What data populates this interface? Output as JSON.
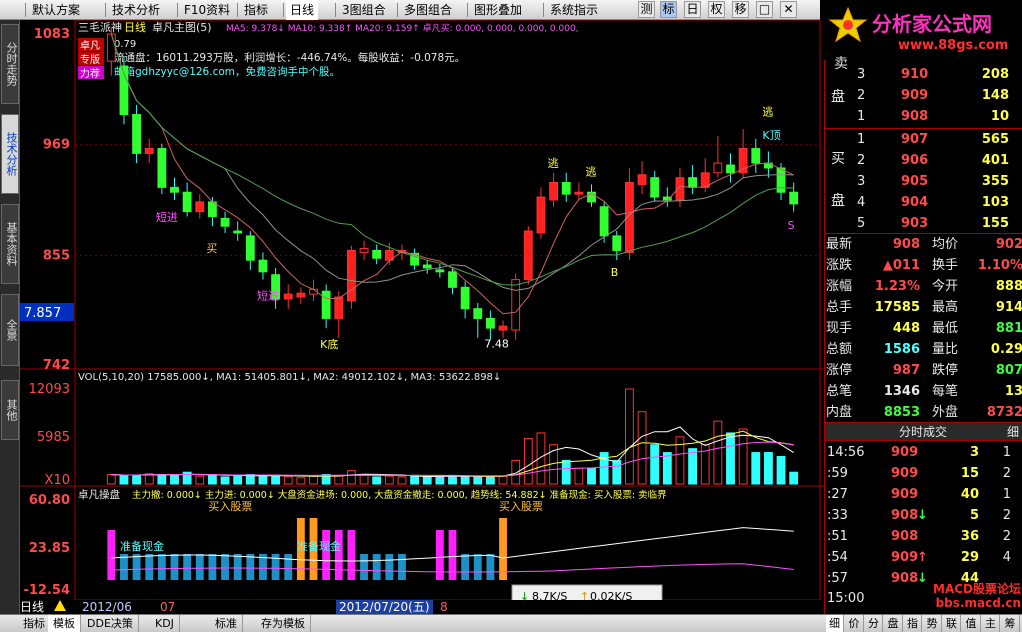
{
  "menu": {
    "items": [
      "默认方案",
      "技术分析",
      "F10资料",
      "指标",
      "日线",
      "3图组合",
      "多图组合",
      "图形叠加",
      "系统指示"
    ],
    "toolbar": [
      "测",
      "标",
      "日",
      "权",
      "移",
      "□",
      "✕"
    ]
  },
  "brand": {
    "name": "分析家公式网",
    "url": "www.88gs.com"
  },
  "left_tabs": [
    "分时走势",
    "技术分析",
    "基本资料",
    "全景",
    "其他"
  ],
  "main": {
    "title": "三毛派神",
    "period": "日线",
    "indicator_title": "卓凡主图(5)",
    "ma_line": "MA5: 9.378↓  MA10: 9.338↑  MA20: 9.159↑  卓凡买: 0.000, 0.000, 0.000, 0.000,",
    "info_line1": "流通盘：16011.293万股，利润增长：-446.74%。每股收益：-0.078元。",
    "info_line2": "邮箱gdhzyyc@126.com，免费咨询手中个股。",
    "price_first": "0.79",
    "side_badges": [
      "卓凡",
      "专版",
      "力荐"
    ],
    "current_price_label": "7.857",
    "y_labels": [
      "1083",
      "969",
      "855",
      "742"
    ],
    "candle_labels": {
      "short_in": "短进",
      "buy": "买",
      "buy_in": "短进",
      "escape": "逃",
      "escape2": "逃",
      "kpeak": "K顶",
      "kbottom": "K底",
      "low_price": "7.48",
      "b": "B",
      "s": "S"
    },
    "vol_title": "VOL(5,10,20)  17585.000↓, MA1: 51405.801↓, MA2: 49012.102↓, MA3: 53622.898↓",
    "vol_labels": [
      "12093",
      "5985",
      "X10"
    ],
    "ind_title": "卓凡操盘",
    "ind_line": "主力撤: 0.000↓  主力进: 0.000↓  大盘资金进场: 0.000, 大盘资金撤走: 0.000, 趋势线: 54.882↓  准备现金: 买入股票: 卖临界",
    "ind_labels": [
      "60.80",
      "23.85",
      "-12.54"
    ],
    "ind_marks": [
      "准备现金",
      "准备现金",
      "买入股票",
      "买入股票"
    ],
    "date_labels": [
      "日线",
      "2012/06",
      "07",
      "2012/07/20(五)",
      "8"
    ],
    "status_speed": [
      "8.7K/S",
      "0.02K/S"
    ]
  },
  "orderbook": {
    "sell_label": "卖盘",
    "buy_label": "买盘",
    "sell": [
      {
        "lvl": "3",
        "price": "910",
        "vol": "208"
      },
      {
        "lvl": "2",
        "price": "909",
        "vol": "148"
      },
      {
        "lvl": "1",
        "price": "908",
        "vol": "10"
      }
    ],
    "buy": [
      {
        "lvl": "1",
        "price": "907",
        "vol": "565"
      },
      {
        "lvl": "2",
        "price": "906",
        "vol": "401"
      },
      {
        "lvl": "3",
        "price": "905",
        "vol": "355"
      },
      {
        "lvl": "4",
        "price": "904",
        "vol": "103"
      },
      {
        "lvl": "5",
        "price": "903",
        "vol": "155"
      }
    ]
  },
  "quote": [
    {
      "k1": "最新",
      "v1": "908",
      "k2": "均价",
      "v2": "902"
    },
    {
      "k1": "涨跌",
      "v1": "▲011",
      "k2": "换手",
      "v2": "1.10%"
    },
    {
      "k1": "涨幅",
      "v1": "1.23%",
      "k2": "今开",
      "v2": "888"
    },
    {
      "k1": "总手",
      "v1": "17585",
      "k2": "最高",
      "v2": "914"
    },
    {
      "k1": "现手",
      "v1": "448",
      "k2": "最低",
      "v2": "881"
    },
    {
      "k1": "总额",
      "v1": "1586",
      "k2": "量比",
      "v2": "0.29"
    },
    {
      "k1": "涨停",
      "v1": "987",
      "k2": "跌停",
      "v2": "807"
    },
    {
      "k1": "总笔",
      "v1": "1346",
      "k2": "每笔",
      "v2": "13"
    },
    {
      "k1": "内盘",
      "v1": "8853",
      "k2": "外盘",
      "v2": "8732"
    }
  ],
  "ticks_header": "分时成交",
  "ticks_tab": "细",
  "ticks": [
    {
      "t": "14:56",
      "p": "909",
      "a": "",
      "v": "3",
      "n": "1"
    },
    {
      "t": ":59",
      "p": "909",
      "a": "",
      "v": "15",
      "n": "2"
    },
    {
      "t": ":27",
      "p": "909",
      "a": "",
      "v": "40",
      "n": "1"
    },
    {
      "t": ":33",
      "p": "908",
      "a": "↓",
      "v": "5",
      "n": "2"
    },
    {
      "t": ":51",
      "p": "908",
      "a": "",
      "v": "36",
      "n": "2"
    },
    {
      "t": ":54",
      "p": "909",
      "a": "↑",
      "v": "29",
      "n": "4"
    },
    {
      "t": ":57",
      "p": "908",
      "a": "↓",
      "v": "44",
      "n": ""
    }
  ],
  "clock": "15:00",
  "watermark": "MACD股票论坛 bbs.macd.cn",
  "bottom_tabs": [
    "指标",
    "模板",
    "DDE决策",
    "KDJ",
    "标准",
    "存为模板"
  ],
  "bottom_right_tabs": [
    "细",
    "价",
    "分",
    "盘",
    "指",
    "势",
    "联",
    "值",
    "主",
    "筹"
  ],
  "chart_data": {
    "type": "candlestick",
    "ylim": [
      742,
      1083
    ],
    "candles": [
      {
        "o": 1055,
        "c": 1083,
        "h": 1090,
        "l": 1040
      },
      {
        "o": 1050,
        "c": 1000,
        "h": 1060,
        "l": 990
      },
      {
        "o": 1000,
        "c": 960,
        "h": 1010,
        "l": 950
      },
      {
        "o": 960,
        "c": 965,
        "h": 975,
        "l": 950
      },
      {
        "o": 965,
        "c": 925,
        "h": 970,
        "l": 918
      },
      {
        "o": 925,
        "c": 920,
        "h": 935,
        "l": 912
      },
      {
        "o": 920,
        "c": 900,
        "h": 930,
        "l": 895
      },
      {
        "o": 900,
        "c": 910,
        "h": 918,
        "l": 893
      },
      {
        "o": 910,
        "c": 895,
        "h": 915,
        "l": 885
      },
      {
        "o": 893,
        "c": 885,
        "h": 900,
        "l": 878
      },
      {
        "o": 880,
        "c": 878,
        "h": 890,
        "l": 870
      },
      {
        "o": 875,
        "c": 850,
        "h": 880,
        "l": 840
      },
      {
        "o": 850,
        "c": 838,
        "h": 858,
        "l": 830
      },
      {
        "o": 835,
        "c": 810,
        "h": 842,
        "l": 800
      },
      {
        "o": 810,
        "c": 815,
        "h": 825,
        "l": 800
      },
      {
        "o": 812,
        "c": 816,
        "h": 822,
        "l": 805
      },
      {
        "o": 815,
        "c": 820,
        "h": 830,
        "l": 808
      },
      {
        "o": 818,
        "c": 790,
        "h": 825,
        "l": 780
      },
      {
        "o": 790,
        "c": 812,
        "h": 818,
        "l": 770
      },
      {
        "o": 808,
        "c": 860,
        "h": 865,
        "l": 800
      },
      {
        "o": 858,
        "c": 862,
        "h": 870,
        "l": 850
      },
      {
        "o": 860,
        "c": 852,
        "h": 866,
        "l": 846
      },
      {
        "o": 850,
        "c": 860,
        "h": 868,
        "l": 845
      },
      {
        "o": 858,
        "c": 860,
        "h": 866,
        "l": 850
      },
      {
        "o": 857,
        "c": 845,
        "h": 862,
        "l": 840
      },
      {
        "o": 845,
        "c": 842,
        "h": 850,
        "l": 836
      },
      {
        "o": 840,
        "c": 838,
        "h": 846,
        "l": 832
      },
      {
        "o": 838,
        "c": 822,
        "h": 842,
        "l": 815
      },
      {
        "o": 822,
        "c": 800,
        "h": 828,
        "l": 790
      },
      {
        "o": 800,
        "c": 790,
        "h": 806,
        "l": 770
      },
      {
        "o": 790,
        "c": 780,
        "h": 798,
        "l": 768
      },
      {
        "o": 778,
        "c": 782,
        "h": 788,
        "l": 770
      },
      {
        "o": 778,
        "c": 830,
        "h": 836,
        "l": 768
      },
      {
        "o": 830,
        "c": 880,
        "h": 885,
        "l": 825
      },
      {
        "o": 878,
        "c": 915,
        "h": 925,
        "l": 872
      },
      {
        "o": 912,
        "c": 930,
        "h": 940,
        "l": 905
      },
      {
        "o": 930,
        "c": 918,
        "h": 940,
        "l": 910
      },
      {
        "o": 918,
        "c": 920,
        "h": 930,
        "l": 912
      },
      {
        "o": 920,
        "c": 910,
        "h": 928,
        "l": 905
      },
      {
        "o": 905,
        "c": 875,
        "h": 910,
        "l": 868
      },
      {
        "o": 875,
        "c": 860,
        "h": 880,
        "l": 850
      },
      {
        "o": 858,
        "c": 930,
        "h": 945,
        "l": 850
      },
      {
        "o": 928,
        "c": 938,
        "h": 952,
        "l": 918
      },
      {
        "o": 935,
        "c": 915,
        "h": 942,
        "l": 910
      },
      {
        "o": 915,
        "c": 912,
        "h": 925,
        "l": 905
      },
      {
        "o": 912,
        "c": 935,
        "h": 945,
        "l": 905
      },
      {
        "o": 935,
        "c": 925,
        "h": 948,
        "l": 918
      },
      {
        "o": 925,
        "c": 940,
        "h": 955,
        "l": 920
      },
      {
        "o": 940,
        "c": 950,
        "h": 978,
        "l": 935
      },
      {
        "o": 948,
        "c": 940,
        "h": 960,
        "l": 930
      },
      {
        "o": 940,
        "c": 965,
        "h": 985,
        "l": 935
      },
      {
        "o": 965,
        "c": 950,
        "h": 975,
        "l": 940
      },
      {
        "o": 950,
        "c": 945,
        "h": 962,
        "l": 935
      },
      {
        "o": 945,
        "c": 920,
        "h": 950,
        "l": 912
      },
      {
        "o": 920,
        "c": 908,
        "h": 930,
        "l": 900
      }
    ],
    "volume": [
      {
        "v": 1200,
        "up": true
      },
      {
        "v": 1100,
        "up": false
      },
      {
        "v": 1150,
        "up": false
      },
      {
        "v": 1300,
        "up": true
      },
      {
        "v": 1200,
        "up": false
      },
      {
        "v": 1100,
        "up": false
      },
      {
        "v": 1500,
        "up": false
      },
      {
        "v": 1000,
        "up": true
      },
      {
        "v": 1100,
        "up": false
      },
      {
        "v": 900,
        "up": false
      },
      {
        "v": 1000,
        "up": false
      },
      {
        "v": 1200,
        "up": false
      },
      {
        "v": 1100,
        "up": false
      },
      {
        "v": 1100,
        "up": false
      },
      {
        "v": 900,
        "up": true
      },
      {
        "v": 800,
        "up": true
      },
      {
        "v": 1000,
        "up": true
      },
      {
        "v": 1200,
        "up": false
      },
      {
        "v": 1100,
        "up": true
      },
      {
        "v": 1700,
        "up": true
      },
      {
        "v": 1200,
        "up": true
      },
      {
        "v": 900,
        "up": false
      },
      {
        "v": 1000,
        "up": true
      },
      {
        "v": 900,
        "up": true
      },
      {
        "v": 1100,
        "up": false
      },
      {
        "v": 900,
        "up": false
      },
      {
        "v": 900,
        "up": false
      },
      {
        "v": 1100,
        "up": false
      },
      {
        "v": 1000,
        "up": false
      },
      {
        "v": 1000,
        "up": false
      },
      {
        "v": 900,
        "up": false
      },
      {
        "v": 1000,
        "up": true
      },
      {
        "v": 3000,
        "up": true
      },
      {
        "v": 5800,
        "up": true
      },
      {
        "v": 6500,
        "up": true
      },
      {
        "v": 5000,
        "up": true
      },
      {
        "v": 3000,
        "up": false
      },
      {
        "v": 2000,
        "up": true
      },
      {
        "v": 2000,
        "up": false
      },
      {
        "v": 4000,
        "up": false
      },
      {
        "v": 3000,
        "up": false
      },
      {
        "v": 12093,
        "up": true
      },
      {
        "v": 9200,
        "up": true
      },
      {
        "v": 5000,
        "up": false
      },
      {
        "v": 4000,
        "up": false
      },
      {
        "v": 6000,
        "up": true
      },
      {
        "v": 4500,
        "up": false
      },
      {
        "v": 5000,
        "up": true
      },
      {
        "v": 8000,
        "up": true
      },
      {
        "v": 6500,
        "up": false
      },
      {
        "v": 7000,
        "up": true
      },
      {
        "v": 4000,
        "up": false
      },
      {
        "v": 4000,
        "up": false
      },
      {
        "v": 3500,
        "up": false
      },
      {
        "v": 1500,
        "up": false
      }
    ]
  }
}
